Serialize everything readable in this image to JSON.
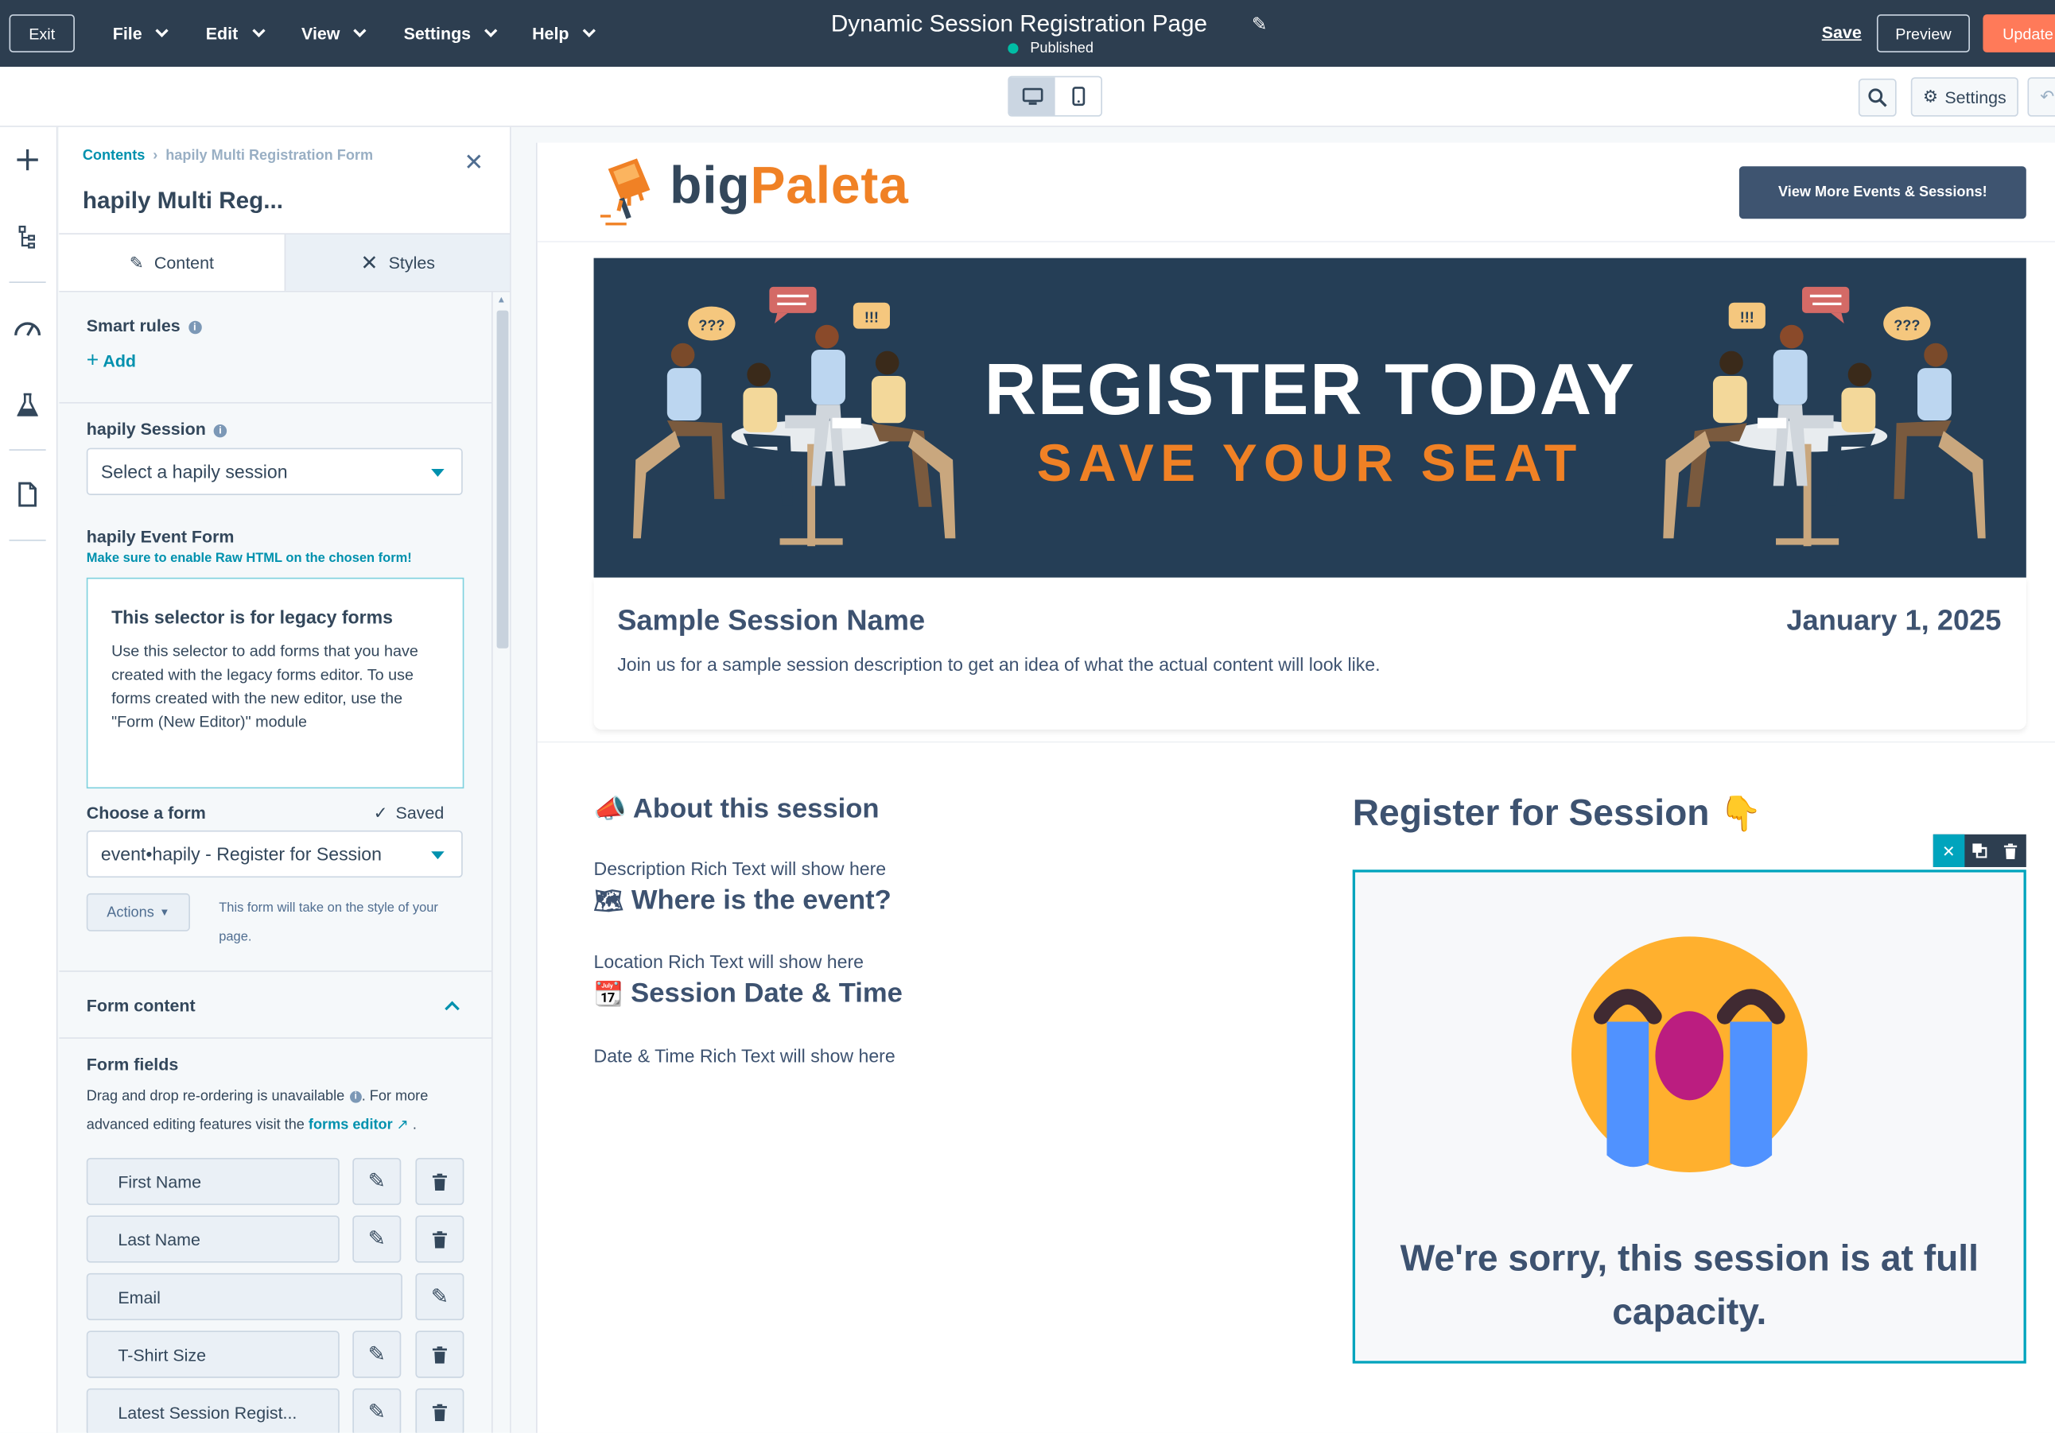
{
  "topbar": {
    "exit": "Exit",
    "menus": [
      "File",
      "Edit",
      "View",
      "Settings",
      "Help"
    ],
    "page_title": "Dynamic Session Registration Page",
    "status": "Published",
    "save": "Save",
    "preview": "Preview",
    "update": "Update"
  },
  "subbar": {
    "settings": "Settings"
  },
  "sidebar": {
    "breadcrumb_root": "Contents",
    "breadcrumb_current": "hapily Multi Registration Form",
    "title": "hapily Multi Reg...",
    "tabs": [
      "Content",
      "Styles"
    ],
    "smart_rules_label": "Smart rules",
    "add_label": "Add",
    "session_label": "hapily Session",
    "session_select": "Select a hapily session",
    "event_form_label": "hapily Event Form",
    "event_form_hint": "Make sure to enable Raw HTML on the chosen form!",
    "legacy_title": "This selector is for legacy forms",
    "legacy_body": "Use this selector to add forms that you have created with the legacy forms editor. To use forms created with the new editor, use the \"Form (New Editor)\" module",
    "choose_form_label": "Choose a form",
    "saved": "Saved",
    "form_select": "event•hapily - Register for Session",
    "actions": "Actions",
    "actions_note": "This form will take on the style of your page.",
    "form_content_label": "Form content",
    "form_fields_label": "Form fields",
    "form_fields_note_1": "Drag and drop re-ordering is unavailable",
    "form_fields_note_2": ". For more advanced editing features visit the",
    "forms_editor_link": "forms editor",
    "fields": [
      {
        "name": "First Name",
        "deletable": true
      },
      {
        "name": "Last Name",
        "deletable": true
      },
      {
        "name": "Email",
        "deletable": false
      },
      {
        "name": "T-Shirt Size",
        "deletable": true
      },
      {
        "name": "Latest Session Regist...",
        "deletable": true
      }
    ]
  },
  "preview": {
    "logo_big": "big",
    "logo_paleta": "Paleta",
    "cta": "View More Events & Sessions!",
    "banner_line1": "REGISTER TODAY",
    "banner_line2": "SAVE YOUR SEAT",
    "banner_bubbles": [
      "???",
      "!!!",
      "!!!",
      "???"
    ],
    "session_name": "Sample Session Name",
    "session_date": "January 1, 2025",
    "session_desc": "Join us for a sample session description to get an idea of what the actual content will look like.",
    "about_heading": "About this session",
    "about_rt": "Description Rich Text will show here",
    "where_heading": "Where is the event?",
    "where_rt": "Location Rich Text will show here",
    "datetime_heading": "Session Date & Time",
    "datetime_rt": "Date & Time Rich Text will show here",
    "register_heading": "Register for Session",
    "full_message": "We're sorry, this session is at full capacity."
  },
  "colors": {
    "topbar": "#2d3e50",
    "accent_teal": "#0091ae",
    "orange": "#f08125",
    "update_orange": "#ff7a59",
    "banner": "#253e56",
    "heading": "#3d5270"
  },
  "icons": [
    "pencil-icon",
    "desktop-icon",
    "mobile-icon",
    "search-icon",
    "gear-icon",
    "undo-icon",
    "plus-icon",
    "tree-icon",
    "gauge-icon",
    "flask-icon",
    "file-icon",
    "close-icon",
    "scissors-icon",
    "trash-icon",
    "clone-icon",
    "megaphone-icon",
    "map-icon",
    "calendar-icon",
    "pointing-down-icon",
    "crying-face-icon",
    "external-link-icon",
    "check-icon"
  ]
}
